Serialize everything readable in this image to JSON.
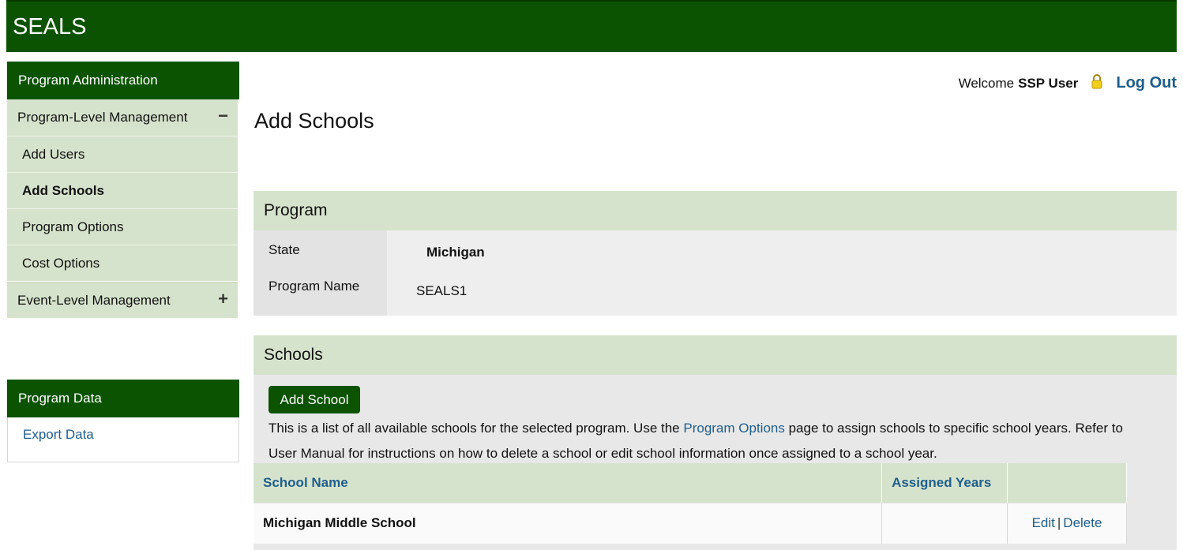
{
  "app": {
    "title": "SEALS"
  },
  "sidebar": {
    "admin_header": "Program Administration",
    "program_level": {
      "label": "Program-Level Management",
      "toggle": "−"
    },
    "items": [
      {
        "label": "Add Users",
        "active": false
      },
      {
        "label": "Add Schools",
        "active": true
      },
      {
        "label": "Program Options",
        "active": false
      },
      {
        "label": "Cost Options",
        "active": false
      }
    ],
    "event_level": {
      "label": "Event-Level Management",
      "toggle": "+"
    },
    "data_header": "Program Data",
    "export_link": "Export Data"
  },
  "user": {
    "welcome": "Welcome",
    "name": "SSP User",
    "logout": "Log Out"
  },
  "page": {
    "title": "Add Schools"
  },
  "program": {
    "header": "Program",
    "state_label": "State",
    "state_value": "Michigan",
    "name_label": "Program Name",
    "name_value": "SEALS1"
  },
  "schools": {
    "header": "Schools",
    "add_button": "Add School",
    "description_pre": "This is a list of all available schools for the selected program. Use the ",
    "description_link": "Program Options",
    "description_post": " page to assign schools to specific school years. Refer to User Manual for instructions on how to delete a school or edit school information once assigned to a school year.",
    "columns": [
      "School Name",
      "Assigned Years",
      ""
    ],
    "rows": [
      {
        "name": "Michigan Middle School",
        "years": "",
        "edit": "Edit",
        "sep": "|",
        "delete": "Delete"
      }
    ]
  },
  "colors": {
    "brand": "#0b5300",
    "panel": "#d6e3cc",
    "link": "#1f5e8c"
  }
}
